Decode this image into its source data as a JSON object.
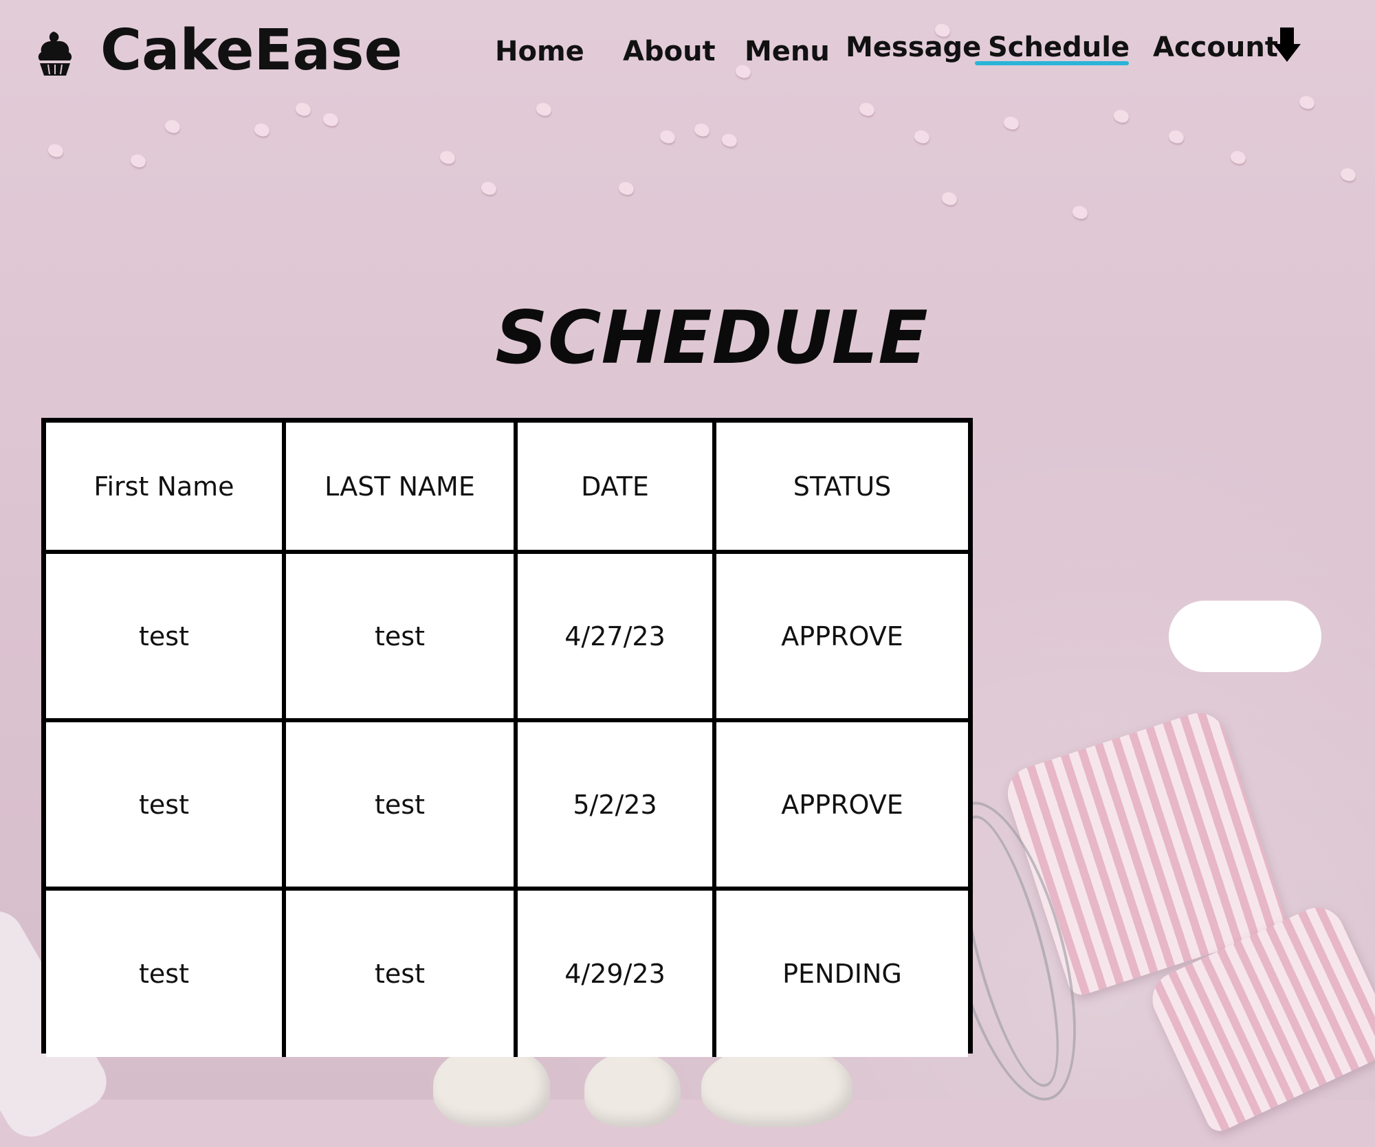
{
  "brand": {
    "name": "CakeEase",
    "logo_icon": "cupcake-icon"
  },
  "nav": {
    "items": [
      {
        "label": "Home"
      },
      {
        "label": "About"
      },
      {
        "label": "Menu"
      },
      {
        "label": "Message"
      },
      {
        "label": "Schedule",
        "active": true
      },
      {
        "label": "Account"
      }
    ],
    "account_icon": "arrow-down-icon",
    "active_color": "#29b4d8"
  },
  "page": {
    "title": "SCHEDULE"
  },
  "schedule_table": {
    "columns": [
      "First Name",
      "LAST NAME",
      "DATE",
      "STATUS"
    ],
    "rows": [
      [
        "test",
        "test",
        "4/27/23",
        "APPROVE"
      ],
      [
        "test",
        "test",
        "5/2/23",
        "APPROVE"
      ],
      [
        "test",
        "test",
        "4/29/23",
        "PENDING"
      ]
    ]
  },
  "side_button": {
    "label": ""
  }
}
